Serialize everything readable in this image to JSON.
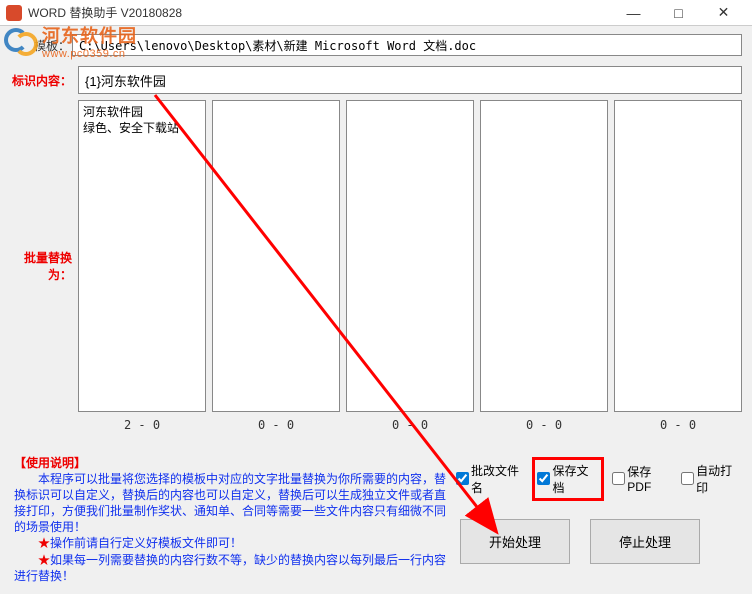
{
  "window": {
    "title": "WORD 替换助手 V20180828"
  },
  "watermark": {
    "text_cn": "河东软件园",
    "url": "www.pc0359.cn"
  },
  "template": {
    "label": "模板：",
    "path": "C:\\Users\\lenovo\\Desktop\\素材\\新建 Microsoft Word 文档.doc"
  },
  "tag": {
    "label": "标识内容：",
    "value": "{1}河东软件园"
  },
  "replace_label": "批量替换为：",
  "columns": [
    {
      "content": "河东软件园\n绿色、安全下载站",
      "indicator": "2 - 0"
    },
    {
      "content": "",
      "indicator": "0 - 0"
    },
    {
      "content": "",
      "indicator": "0 - 0"
    },
    {
      "content": "",
      "indicator": "0 - 0"
    },
    {
      "content": "",
      "indicator": "0 - 0"
    }
  ],
  "instructions": {
    "title": "【使用说明】",
    "line1": "　　本程序可以批量将您选择的模板中对应的文字批量替换为你所需要的内容，替换标识可以自定义，替换后的内容也可以自定义，替换后可以生成独立文件或者直接打印，方便我们批量制作奖状、通知单、合同等需要一些文件内容只有细微不同的场景使用！",
    "star2": "★",
    "line2": "操作前请自行定义好模板文件即可！",
    "star3": "★",
    "line3": "如果每一列需要替换的内容行数不等，缺少的替换内容以每列最后一行内容进行替换！"
  },
  "checkboxes": {
    "cb1": {
      "label": "批改文件名",
      "checked": true
    },
    "cb2": {
      "label": "保存文档",
      "checked": true
    },
    "cb3": {
      "label": "保存PDF",
      "checked": false
    },
    "cb4": {
      "label": "自动打印",
      "checked": false
    }
  },
  "buttons": {
    "start": "开始处理",
    "stop": "停止处理"
  }
}
